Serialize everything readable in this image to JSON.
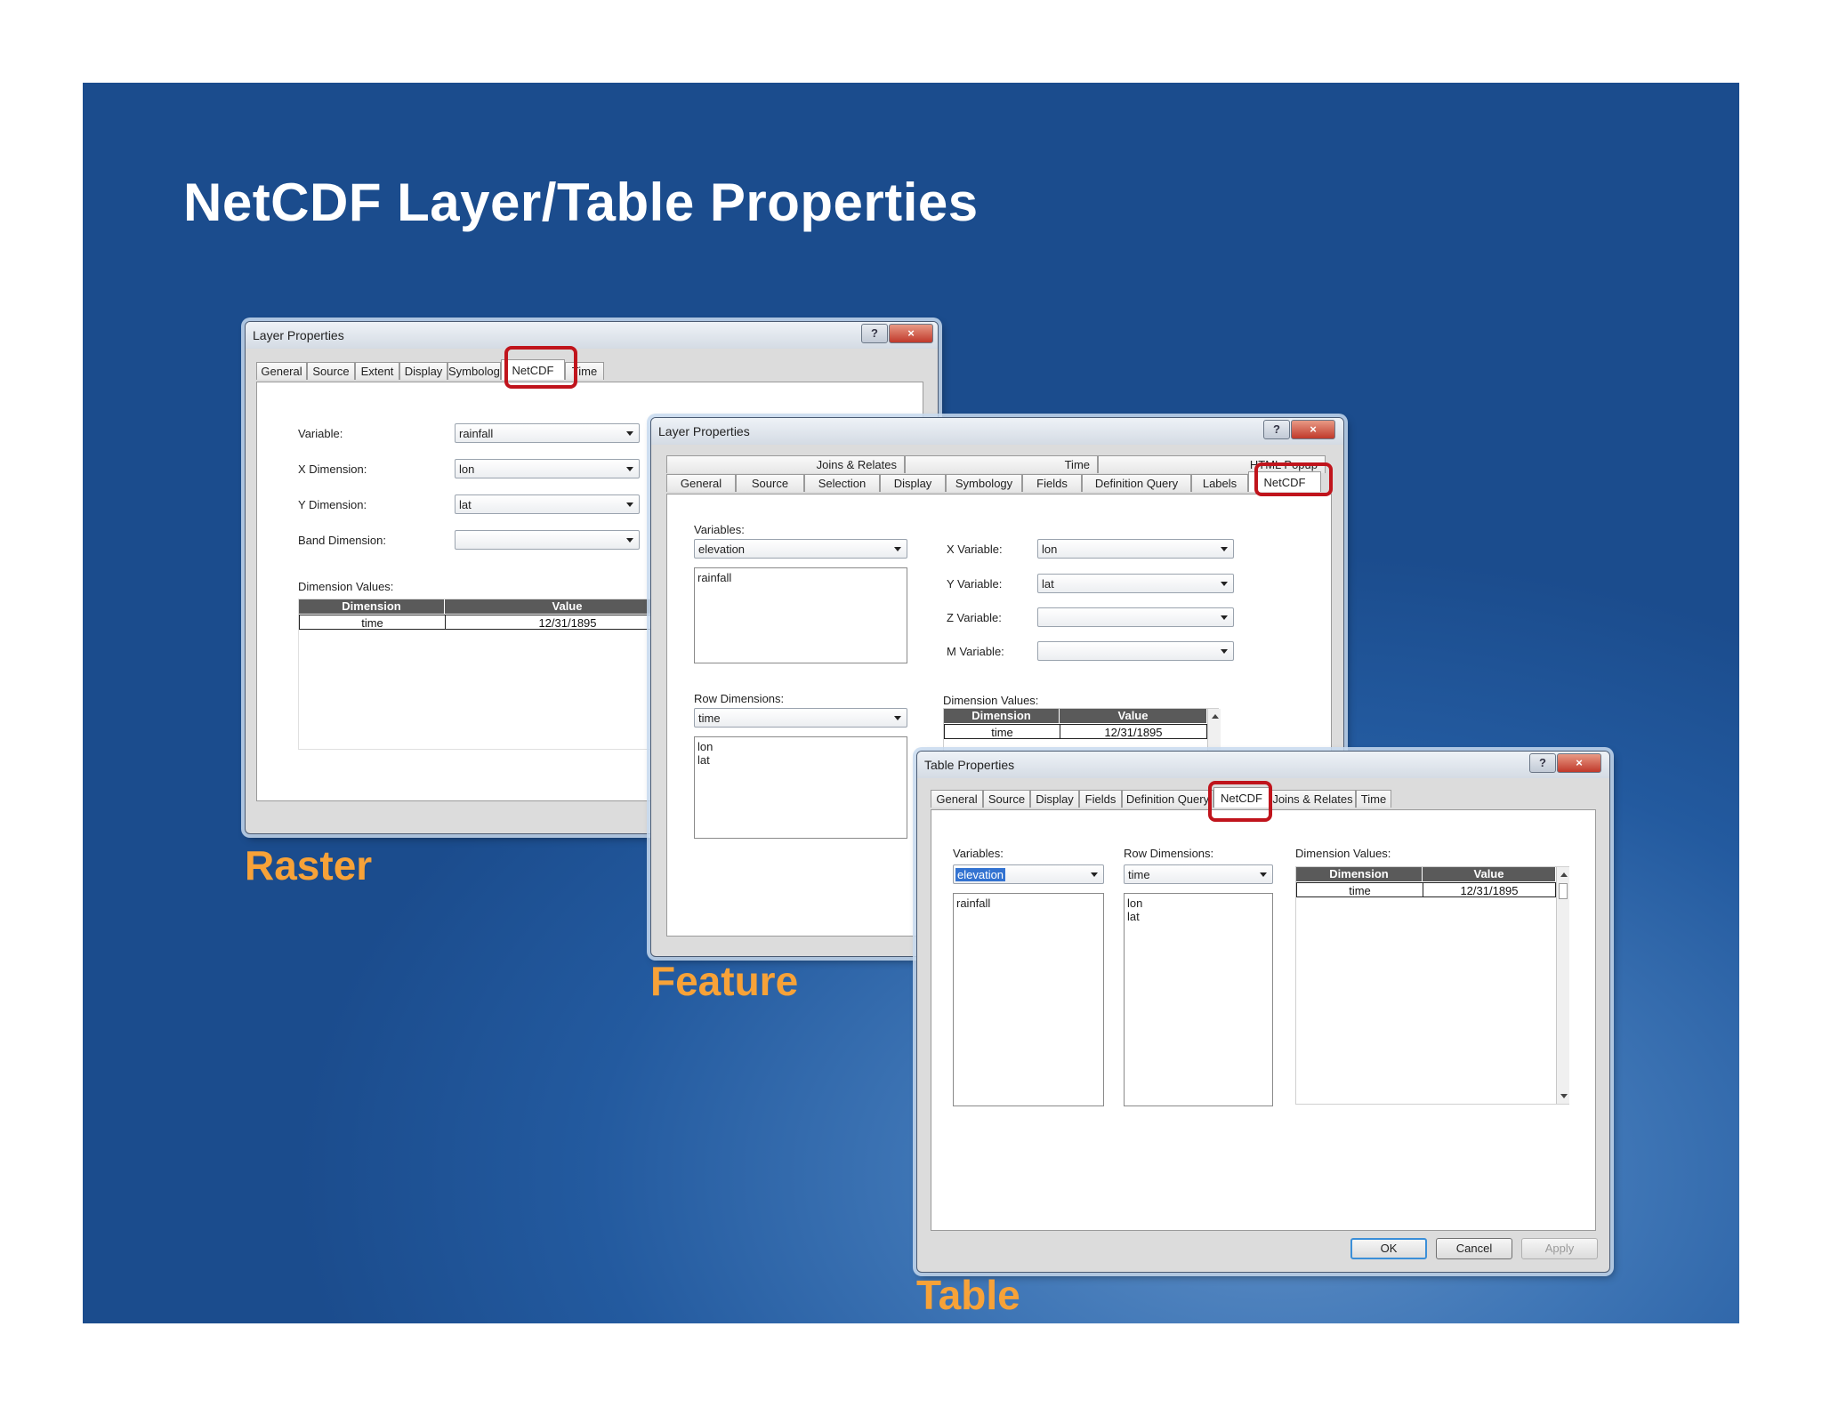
{
  "slide": {
    "title": "NetCDF Layer/Table Properties"
  },
  "captions": {
    "raster": "Raster",
    "feature": "Feature",
    "table": "Table"
  },
  "colors": {
    "background": "#1f5496",
    "caption": "#f7a238",
    "highlight": "#c0141c",
    "grid_header": "#5a5a5a"
  },
  "window_controls": {
    "help": "?",
    "close": "×"
  },
  "raster_dialog": {
    "title": "Layer Properties",
    "tabs": [
      "General",
      "Source",
      "Extent",
      "Display",
      "Symbology",
      "NetCDF",
      "Time"
    ],
    "active_tab": "NetCDF",
    "variable_label": "Variable:",
    "variable_value": "rainfall",
    "xdim_label": "X Dimension:",
    "xdim_value": "lon",
    "ydim_label": "Y Dimension:",
    "ydim_value": "lat",
    "banddim_label": "Band Dimension:",
    "banddim_value": "",
    "dimvalues_label": "Dimension Values:",
    "grid": {
      "headers": [
        "Dimension",
        "Value"
      ],
      "rows": [
        [
          "time",
          "12/31/1895"
        ]
      ]
    }
  },
  "feature_dialog": {
    "title": "Layer Properties",
    "tabs_row1": [
      "Joins & Relates",
      "Time",
      "HTML Popup"
    ],
    "tabs_row2": [
      "General",
      "Source",
      "Selection",
      "Display",
      "Symbology",
      "Fields",
      "Definition Query",
      "Labels",
      "NetCDF"
    ],
    "active_tab": "NetCDF",
    "variables_label": "Variables:",
    "variables_value": "elevation",
    "variables_list": [
      "rainfall"
    ],
    "xvar_label": "X Variable:",
    "xvar_value": "lon",
    "yvar_label": "Y Variable:",
    "yvar_value": "lat",
    "zvar_label": "Z Variable:",
    "zvar_value": "",
    "mvar_label": "M Variable:",
    "mvar_value": "",
    "rowdim_label": "Row Dimensions:",
    "rowdim_value": "time",
    "rowdim_list": [
      "lon",
      "lat"
    ],
    "dimvalues_label": "Dimension Values:",
    "grid": {
      "headers": [
        "Dimension",
        "Value"
      ],
      "rows": [
        [
          "time",
          "12/31/1895"
        ]
      ]
    }
  },
  "table_dialog": {
    "title": "Table Properties",
    "tabs": [
      "General",
      "Source",
      "Display",
      "Fields",
      "Definition Query",
      "NetCDF",
      "Joins & Relates",
      "Time"
    ],
    "active_tab": "NetCDF",
    "variables_label": "Variables:",
    "variables_value": "elevation",
    "variables_list": [
      "rainfall"
    ],
    "rowdim_label": "Row Dimensions:",
    "rowdim_value": "time",
    "rowdim_list": [
      "lon",
      "lat"
    ],
    "dimvalues_label": "Dimension Values:",
    "grid": {
      "headers": [
        "Dimension",
        "Value"
      ],
      "rows": [
        [
          "time",
          "12/31/1895"
        ]
      ]
    },
    "buttons": {
      "ok": "OK",
      "cancel": "Cancel",
      "apply": "Apply"
    }
  }
}
